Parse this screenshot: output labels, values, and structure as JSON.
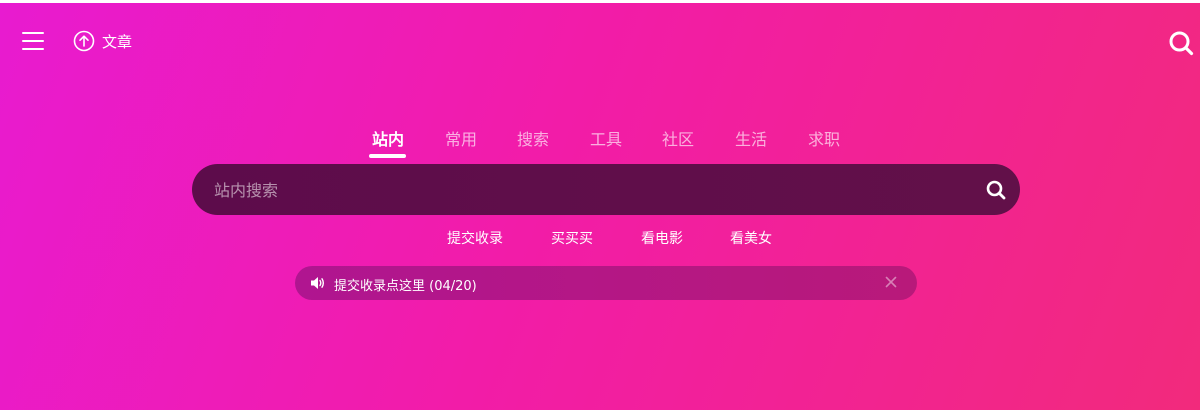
{
  "header": {
    "article_label": "文章"
  },
  "tabs": [
    {
      "label": "站内",
      "active": true
    },
    {
      "label": "常用",
      "active": false
    },
    {
      "label": "搜索",
      "active": false
    },
    {
      "label": "工具",
      "active": false
    },
    {
      "label": "社区",
      "active": false
    },
    {
      "label": "生活",
      "active": false
    },
    {
      "label": "求职",
      "active": false
    }
  ],
  "search": {
    "placeholder": "站内搜索",
    "value": ""
  },
  "quick_links": [
    {
      "label": "提交收录"
    },
    {
      "label": "买买买"
    },
    {
      "label": "看电影"
    },
    {
      "label": "看美女"
    }
  ],
  "notice": {
    "text": "提交收录点这里 (04/20)"
  },
  "icons": {
    "menu": "menu-icon",
    "article": "arrow-up-circle-icon",
    "search": "search-icon",
    "speaker": "speaker-icon",
    "close": "close-icon"
  },
  "colors": {
    "background_start": "#e81bd0",
    "background_end": "#f22a7c",
    "search_bar": "#5d0c4b",
    "notice_bar": "#b01590"
  }
}
